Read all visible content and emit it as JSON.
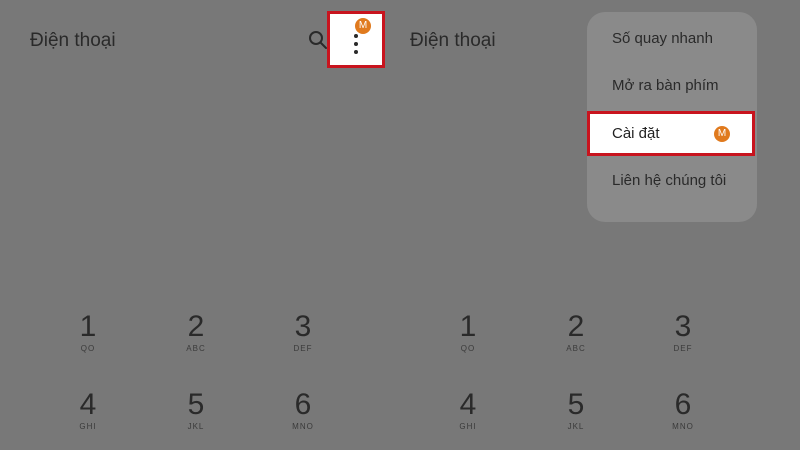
{
  "left_panel": {
    "title": "Điện thoại",
    "badge": "M"
  },
  "right_panel": {
    "title": "Điện thoại",
    "menu": {
      "items": [
        {
          "label": "Số quay nhanh"
        },
        {
          "label": "Mở ra bàn phím"
        },
        {
          "label": "Cài đặt",
          "badge": "M"
        },
        {
          "label": "Liên hệ chúng tôi"
        }
      ]
    }
  },
  "keypad": [
    {
      "digit": "1",
      "letters": "QO"
    },
    {
      "digit": "2",
      "letters": "ABC"
    },
    {
      "digit": "3",
      "letters": "DEF"
    },
    {
      "digit": "4",
      "letters": "GHI"
    },
    {
      "digit": "5",
      "letters": "JKL"
    },
    {
      "digit": "6",
      "letters": "MNO"
    }
  ],
  "colors": {
    "highlight_border": "#c8141e",
    "badge": "#e07a1e",
    "background_dim": "#787878"
  },
  "icons": [
    "search-icon",
    "more-vertical-icon"
  ]
}
